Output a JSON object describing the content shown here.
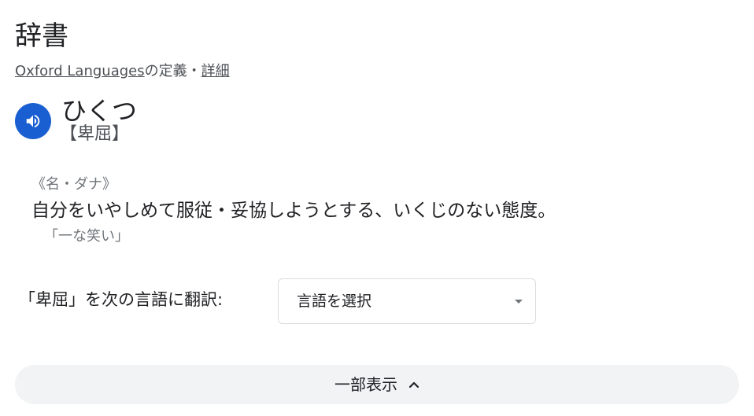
{
  "header": {
    "title": "辞書"
  },
  "source": {
    "provider_link": "Oxford Languages",
    "suffix": "の定義",
    "separator": "・",
    "details_link": "詳細"
  },
  "entry": {
    "reading": "ひくつ",
    "kanji": "【卑屈】",
    "part_of_speech": "《名・ダナ》",
    "definition": "自分をいやしめて服従・妥協しようとする、いくじのない態度。",
    "example": "「一な笑い」"
  },
  "translate": {
    "label": "「卑屈」を次の言語に翻訳:",
    "select_value": "言語を選択"
  },
  "footer": {
    "collapse_label": "一部表示"
  },
  "colors": {
    "accent": "#1a5fd1",
    "pill_background": "#f1f3f4",
    "text_primary": "#202124",
    "text_secondary": "#70757a"
  },
  "icons": {
    "speaker": "speaker-icon",
    "dropdown": "dropdown-arrow-icon",
    "collapse": "chevron-up-icon"
  }
}
